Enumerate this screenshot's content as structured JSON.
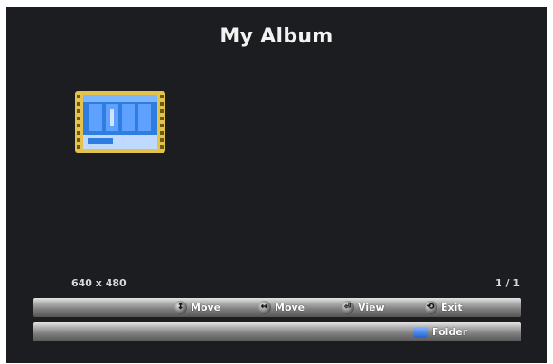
{
  "screen": {
    "title": "My Album",
    "resolution": "640 x 480",
    "page_indicator": "1 / 1"
  },
  "thumbnail": {
    "icon": "filmstrip-folder-icon",
    "accent": "#2f7de1",
    "frame_color": "#d9b23a"
  },
  "hints_bar": {
    "items": [
      {
        "icon": "up-down-arrows-icon",
        "label": "Move"
      },
      {
        "icon": "left-right-arrows-icon",
        "label": "Move"
      },
      {
        "icon": "enter-icon",
        "label": "View"
      },
      {
        "icon": "exit-icon",
        "label": "Exit"
      }
    ]
  },
  "secondary_bar": {
    "folder_icon": "folder-icon",
    "folder_label": "Folder"
  }
}
